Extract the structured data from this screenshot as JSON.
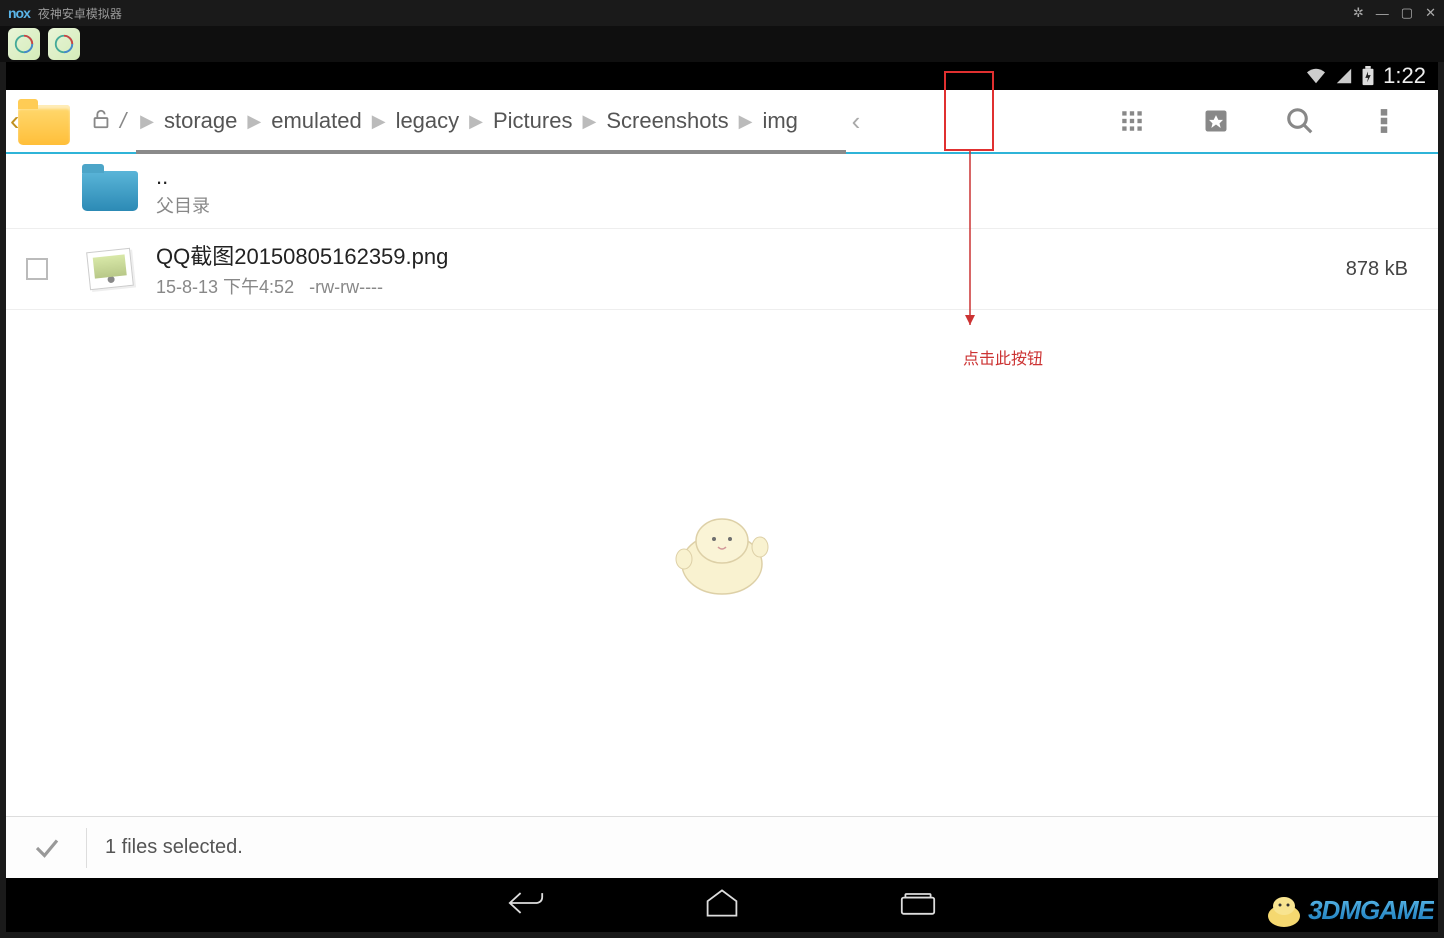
{
  "emulator": {
    "brand": "nox",
    "title": "夜神安卓模拟器"
  },
  "status": {
    "time": "1:22"
  },
  "breadcrumb": {
    "root": "/",
    "items": [
      "storage",
      "emulated",
      "legacy",
      "Pictures",
      "Screenshots",
      "img"
    ]
  },
  "files": {
    "parent": {
      "name": "..",
      "label": "父目录"
    },
    "items": [
      {
        "name": "QQ截图20150805162359.png",
        "date": "15-8-13 下午4:52",
        "perm": "-rw-rw----",
        "size": "878 kB"
      }
    ]
  },
  "selection": {
    "text": "1 files selected."
  },
  "annotation": {
    "text": "点击此按钮"
  },
  "watermark": "3DMGAME"
}
